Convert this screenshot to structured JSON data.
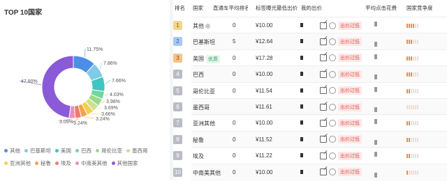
{
  "left_panel": {
    "title": "TOP 10国家",
    "pie_labels": [
      "11.75%",
      "7.86%",
      "7.66%",
      "4.03%",
      "3.98%",
      "3.69%",
      "3.66%",
      "3.24%",
      "3.24%",
      "3.09%",
      "47.80%"
    ],
    "legend": [
      {
        "label": "其他",
        "color": "#4d8fe6"
      },
      {
        "label": "巴基斯坦",
        "color": "#7fcbe8"
      },
      {
        "label": "美国",
        "color": "#3fc6c0"
      },
      {
        "label": "巴西",
        "color": "#6fd6a0"
      },
      {
        "label": "哥伦比亚",
        "color": "#9bd98a"
      },
      {
        "label": "墨西哥",
        "color": "#cfe08a"
      },
      {
        "label": "亚洲其他",
        "color": "#f4cf4a"
      },
      {
        "label": "秘鲁",
        "color": "#f4a24a"
      },
      {
        "label": "埃及",
        "color": "#f27a6a"
      },
      {
        "label": "中南美其他",
        "color": "#ef8cc0"
      },
      {
        "label": "其他国家",
        "color": "#8a5ad8"
      }
    ]
  },
  "chart_data": {
    "type": "pie",
    "title": "TOP 10国家",
    "values": [
      11.75,
      7.86,
      7.66,
      4.03,
      3.98,
      3.69,
      3.66,
      3.24,
      3.24,
      3.09,
      47.8
    ],
    "categories": [
      "其他",
      "巴基斯坦",
      "美国",
      "巴西",
      "哥伦比亚",
      "墨西哥",
      "亚洲其他",
      "秘鲁",
      "埃及",
      "中南美其他",
      "其他国家"
    ],
    "legend": "bottom"
  },
  "table": {
    "headers": {
      "rank": "排名",
      "country": "国家",
      "avg_rank": "直通车平均排名",
      "min_bid": "标签曝光最低出价",
      "my_bid": "我的出价",
      "avg_cost": "平均点击花费",
      "competition": "国家竞争度"
    },
    "bid_button": "出价过低",
    "rows": [
      {
        "rank": "1",
        "country": "其他",
        "tag": "",
        "avg": "0",
        "min": "¥10.00",
        "level": 4
      },
      {
        "rank": "2",
        "country": "巴基斯坦",
        "tag": "",
        "avg": "5",
        "min": "¥12.64",
        "level": 3
      },
      {
        "rank": "3",
        "country": "美国",
        "tag": "优质",
        "avg": "0",
        "min": "¥17.28",
        "level": 3
      },
      {
        "rank": "4",
        "country": "巴西",
        "tag": "",
        "avg": "0",
        "min": "¥10.00",
        "level": 3
      },
      {
        "rank": "5",
        "country": "哥伦比亚",
        "tag": "",
        "avg": "0",
        "min": "¥11.54",
        "level": 2
      },
      {
        "rank": "6",
        "country": "墨西哥",
        "tag": "",
        "avg": "",
        "min": "¥11.61",
        "level": 0
      },
      {
        "rank": "7",
        "country": "亚洲其他",
        "tag": "",
        "avg": "0",
        "min": "¥10.00",
        "level": 2
      },
      {
        "rank": "8",
        "country": "秘鲁",
        "tag": "",
        "avg": "0",
        "min": "¥11.52",
        "level": 2
      },
      {
        "rank": "9",
        "country": "埃及",
        "tag": "",
        "avg": "0",
        "min": "¥11.22",
        "level": 2
      },
      {
        "rank": "10",
        "country": "中南美其他",
        "tag": "",
        "avg": "0",
        "min": "¥10.00",
        "level": 1
      }
    ]
  }
}
